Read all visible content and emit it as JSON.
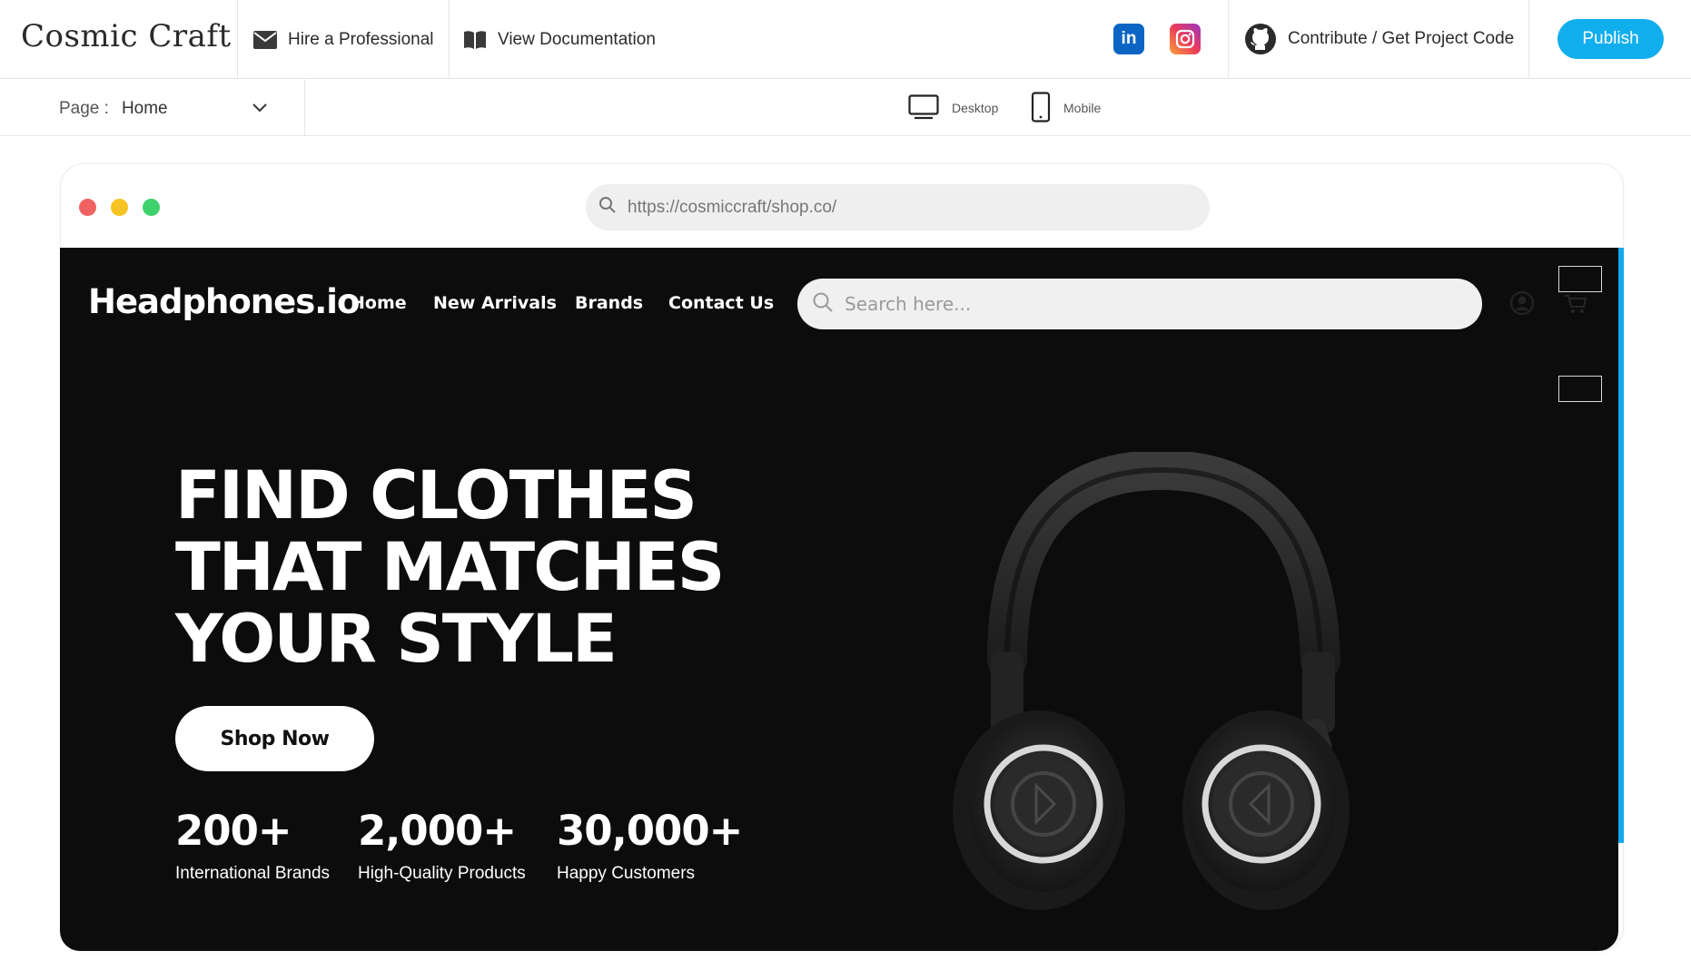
{
  "app": {
    "title": "Cosmic Craft",
    "hire_label": "Hire a Professional",
    "docs_label": "View Documentation",
    "contribute_label": "Contribute / Get Project Code",
    "publish_label": "Publish",
    "linkedin_text": "in",
    "icons": [
      "envelope-icon",
      "book-icon",
      "linkedin-icon",
      "instagram-icon",
      "github-icon"
    ],
    "accent_color": "#11aeee"
  },
  "subbar": {
    "page_label": "Page :",
    "page_value": "Home",
    "desktop_label": "Desktop",
    "mobile_label": "Mobile"
  },
  "browser": {
    "url": "https://cosmiccraft/shop.co/",
    "window_dots": [
      "#f06262",
      "#f6c324",
      "#3ed16c"
    ]
  },
  "site": {
    "logo": "Headphones.io",
    "nav": [
      "Home",
      "New Arrivals",
      "Brands",
      "Contact Us"
    ],
    "search_placeholder": "Search here...",
    "hero_lines": [
      "FIND CLOTHES",
      "THAT MATCHES",
      "YOUR STYLE"
    ],
    "cta": "Shop Now",
    "stats": [
      {
        "value": "200+",
        "label": "International Brands"
      },
      {
        "value": "2,000+",
        "label": "High-Quality Products"
      },
      {
        "value": "30,000+",
        "label": "Happy Customers"
      }
    ],
    "background_color": "#0c0c0c"
  }
}
